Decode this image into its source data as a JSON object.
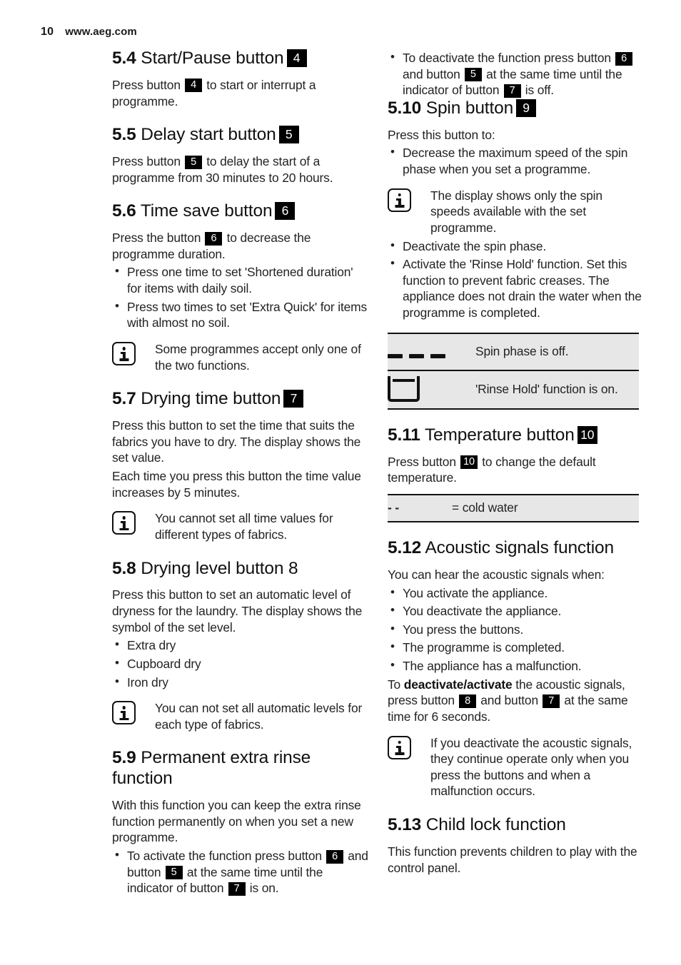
{
  "header": {
    "page_number": "10",
    "site_url": "www.aeg.com"
  },
  "left_column": {
    "sections": [
      {
        "id": "5.4",
        "number": "5.4",
        "title": "Start/Pause button",
        "badge": "4",
        "paragraph_a": "Press button ",
        "paragraph_key": "4",
        "paragraph_b": " to start or interrupt a programme."
      },
      {
        "id": "5.5",
        "number": "5.5",
        "title": "Delay start button",
        "badge": "5",
        "paragraph_a": "Press button ",
        "paragraph_key": "5",
        "paragraph_b": " to delay the start of a programme from 30 minutes to 20 hours."
      },
      {
        "id": "5.6",
        "number": "5.6",
        "title": "Time save button",
        "badge": "6",
        "paragraph_a": "Press the button ",
        "paragraph_key": "6",
        "paragraph_b": " to decrease the programme duration.",
        "bullets": [
          "Press one time to set 'Shortened duration' for items with daily soil.",
          "Press two times to set 'Extra Quick' for items with almost no soil."
        ],
        "note": "Some programmes accept only one of the two functions."
      },
      {
        "id": "5.7",
        "number": "5.7",
        "title": "Drying time button",
        "badge": "7",
        "paragraph_a": "Press this button to set the time that suits the fabrics you have to dry. The display shows the set value.",
        "paragraph_b": "Each time you press this button the time value increases by 5 minutes.",
        "note": "You cannot set all time values for different types of fabrics."
      },
      {
        "id": "5.8",
        "number": "5.8",
        "title": "Drying level button 8",
        "badge": "",
        "paragraph_a": "Press this button to set an automatic level of dryness for the laundry. The display shows the symbol of the set level.",
        "bullets": [
          "Extra dry",
          "Cupboard dry",
          "Iron dry"
        ],
        "note": "You can not set all automatic levels for each type of fabrics."
      },
      {
        "id": "5.9",
        "number": "5.9",
        "title": "Permanent extra rinse function",
        "badge": "",
        "paragraph_a": "With this function you can keep the extra rinse function permanently on when you set a new programme.",
        "bullet_activate": {
          "part_a": "To activate the function press button ",
          "key_1": "6",
          "part_b": " and button ",
          "key_2": "5",
          "part_c": " at the same time until the indicator of button ",
          "key_3": "7",
          "part_d": " is on."
        }
      }
    ]
  },
  "right_column": {
    "continued_bullet": {
      "part_a": "To deactivate the function press button ",
      "key_1": "6",
      "part_b": " and button ",
      "key_2": "5",
      "part_c": " at the same time until the indicator of button ",
      "key_3": "7",
      "part_d": " is off."
    },
    "sections": [
      {
        "id": "5.10",
        "number": "5.10",
        "title": "Spin button",
        "badge": "9",
        "paragraph_a": "Press this button to:",
        "bullet_1": "Decrease the maximum speed of the spin phase when you set a programme.",
        "note": "The display shows only the spin speeds available with the set programme.",
        "bullet_2": "Deactivate the spin phase.",
        "bullet_3": "Activate the 'Rinse Hold' function. Set this function to prevent fabric creases. The appliance does not drain the water when the programme is completed.",
        "table": {
          "rows": [
            {
              "symbol": "dashes-icon",
              "description": "Spin phase is off."
            },
            {
              "symbol": "rinse-hold-tub-icon",
              "description": "'Rinse Hold' function is on."
            }
          ]
        }
      },
      {
        "id": "5.11",
        "number": "5.11",
        "title": "Temperature button",
        "badge": "10",
        "paragraph_a": "Press button ",
        "paragraph_key": "10",
        "paragraph_b": " to change the default temperature.",
        "table": {
          "rows": [
            {
              "symbol": "- -",
              "description": "= cold water"
            }
          ]
        }
      },
      {
        "id": "5.12",
        "number": "5.12",
        "title": "Acoustic signals function",
        "badge": "",
        "paragraph_a": "You can hear the acoustic signals when:",
        "bullets": [
          "You activate the appliance.",
          "You deactivate the appliance.",
          "You press the buttons.",
          "The programme is completed.",
          "The appliance has a malfunction."
        ],
        "closing": {
          "part_a": "To ",
          "strong": "deactivate/activate",
          "part_b": " the acoustic signals, press button ",
          "key_1": "8",
          "part_c": " and button ",
          "key_2": "7",
          "part_d": " at the same time for 6 seconds."
        },
        "note": "If you deactivate the acoustic signals, they continue operate only when you press the buttons and when a malfunction occurs."
      },
      {
        "id": "5.13",
        "number": "5.13",
        "title": "Child lock function",
        "badge": "",
        "paragraph_a": "This function prevents children to play with the control panel."
      }
    ]
  }
}
